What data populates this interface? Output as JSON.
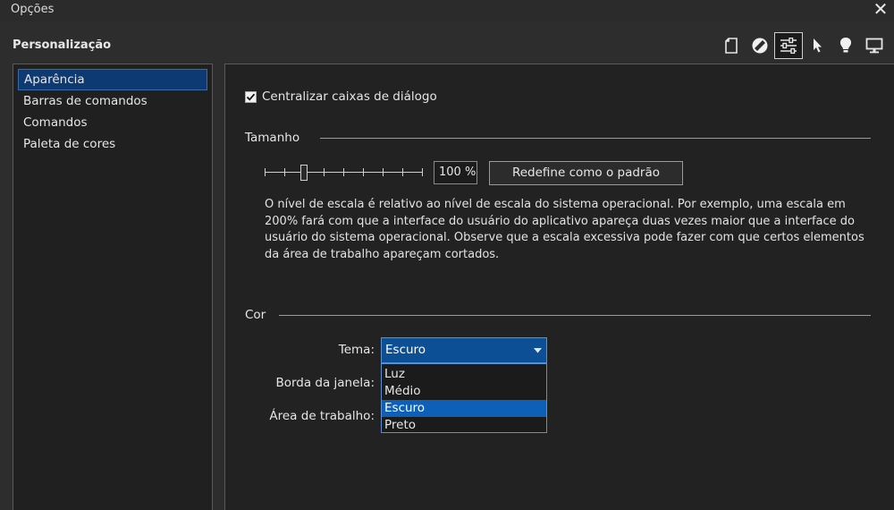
{
  "window": {
    "title": "Opções"
  },
  "section": {
    "title": "Personalização"
  },
  "toolbar": {
    "items": [
      {
        "icon": "blank-page-icon"
      },
      {
        "icon": "no-symbol-icon"
      },
      {
        "icon": "sliders-icon",
        "active": true
      },
      {
        "icon": "pointer-icon"
      },
      {
        "icon": "lightbulb-icon"
      },
      {
        "icon": "monitor-icon"
      }
    ]
  },
  "sidebar": {
    "items": [
      {
        "label": "Aparência",
        "selected": true
      },
      {
        "label": "Barras de comandos"
      },
      {
        "label": "Comandos"
      },
      {
        "label": "Paleta de cores"
      }
    ]
  },
  "options": {
    "center_dialogs": {
      "label": "Centralizar caixas de diálogo",
      "checked": true
    }
  },
  "size": {
    "group_label": "Tamanho",
    "slider_value_percent": 100,
    "percent_text": "100 %",
    "reset_label": "Redefine como o padrão",
    "description": "O nível de escala é relativo ao nível de escala do sistema operacional. Por exemplo, uma escala em 200% fará com que a interface do usuário do aplicativo apareça duas vezes maior que a interface do usuário do sistema operacional. Observe que a escala excessiva pode fazer com que certos elementos da área de trabalho apareçam cortados."
  },
  "color": {
    "group_label": "Cor",
    "theme_label": "Tema:",
    "theme_value": "Escuro",
    "theme_options": [
      "Luz",
      "Médio",
      "Escuro",
      "Preto"
    ],
    "window_border_label": "Borda da janela:",
    "workspace_label": "Área de trabalho:"
  },
  "colors": {
    "accent": "#0d4f94",
    "selection": "#0d5fb8",
    "sidebar_selected": "#0d3a73"
  }
}
